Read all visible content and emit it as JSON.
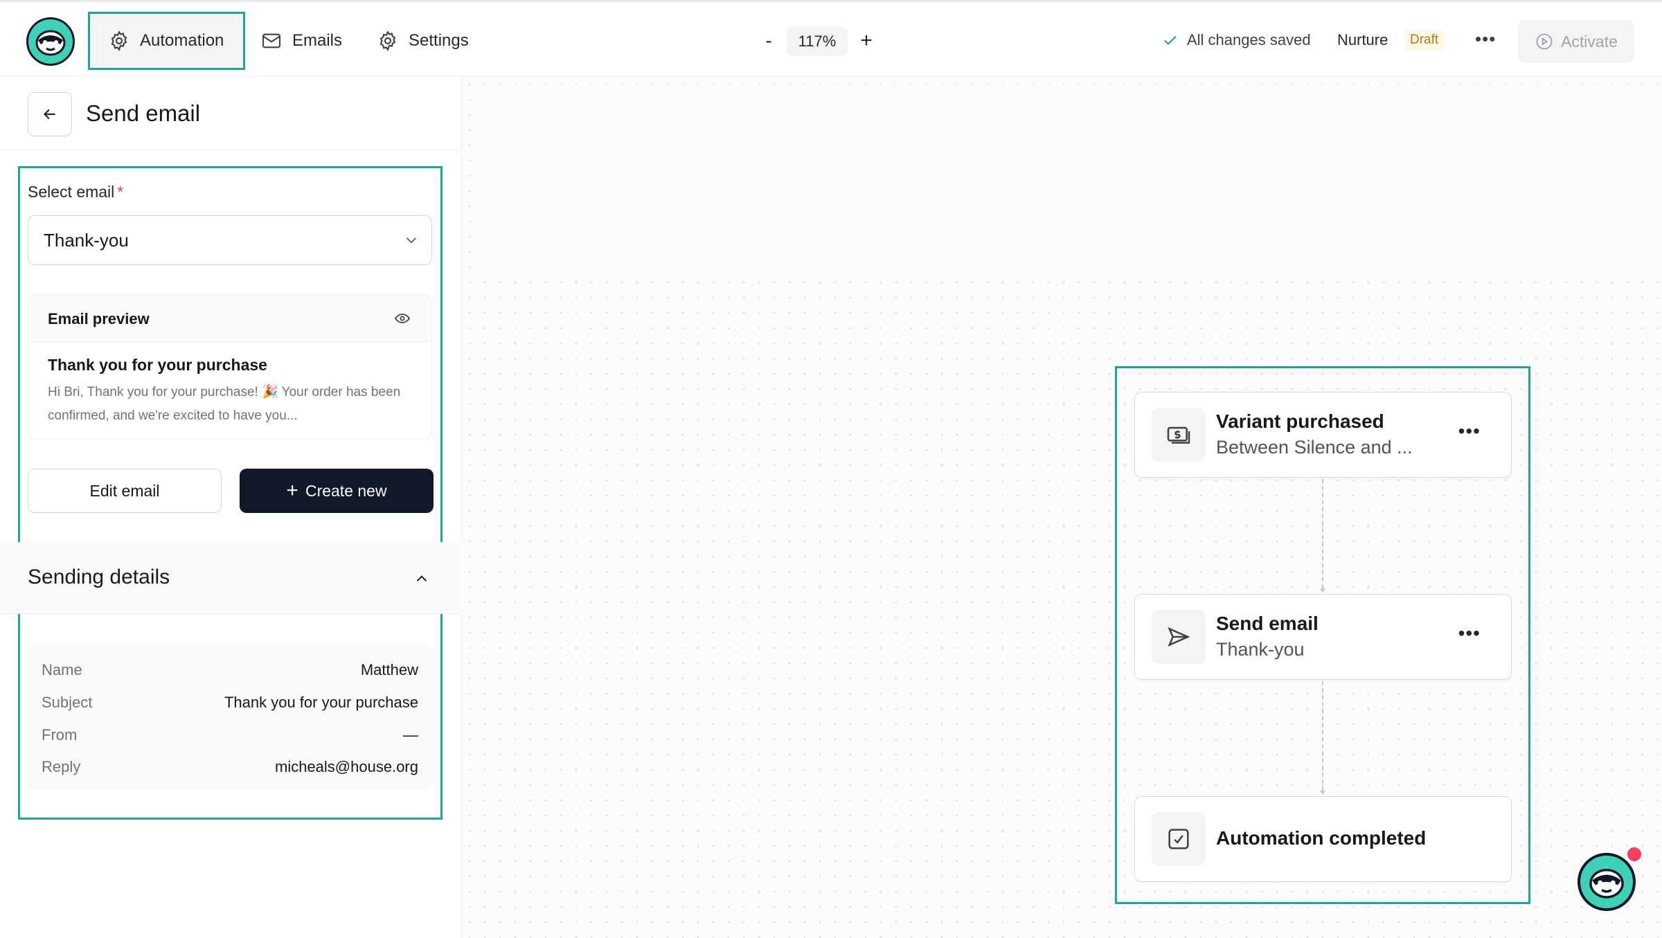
{
  "topbar": {
    "nav": [
      {
        "label": "Automation",
        "icon": "gear-icon",
        "active": true
      },
      {
        "label": "Emails",
        "icon": "mail-icon"
      },
      {
        "label": "Settings",
        "icon": "gear-icon"
      }
    ],
    "zoom": {
      "minus": "-",
      "value": "117%",
      "plus": "+"
    },
    "save_status": "All changes saved",
    "flow_name": "Nurture",
    "status_badge": "Draft",
    "more": "•••",
    "activate_label": "Activate"
  },
  "panel": {
    "title": "Send email",
    "select_label": "Select email",
    "required_mark": "*",
    "selected_email": "Thank-you",
    "preview": {
      "heading": "Email preview",
      "subject": "Thank you for your purchase",
      "body": "Hi Bri, Thank you for your purchase! 🎉 Your order has been confirmed, and we're excited to have you..."
    },
    "edit_button": "Edit email",
    "create_button": "Create new",
    "create_plus": "+",
    "sending_details": {
      "heading": "Sending details",
      "rows": [
        {
          "key": "Name",
          "value": "Matthew"
        },
        {
          "key": "Subject",
          "value": "Thank you for your purchase"
        },
        {
          "key": "From",
          "value": "—"
        },
        {
          "key": "Reply",
          "value": "micheals@house.org"
        }
      ]
    }
  },
  "flow": {
    "nodes": [
      {
        "title": "Variant purchased",
        "subtitle": "Between Silence and ...",
        "icon": "money-icon",
        "menu": "•••"
      },
      {
        "title": "Send email",
        "subtitle": "Thank-you",
        "icon": "send-icon",
        "menu": "•••"
      },
      {
        "title": "Automation completed",
        "icon": "checkbox-icon"
      }
    ]
  },
  "colors": {
    "accent": "#22a39a",
    "brand": "#3fd0b6",
    "primary_button": "#111827",
    "draft_text": "#b7791f",
    "notification": "#f43f5e"
  }
}
